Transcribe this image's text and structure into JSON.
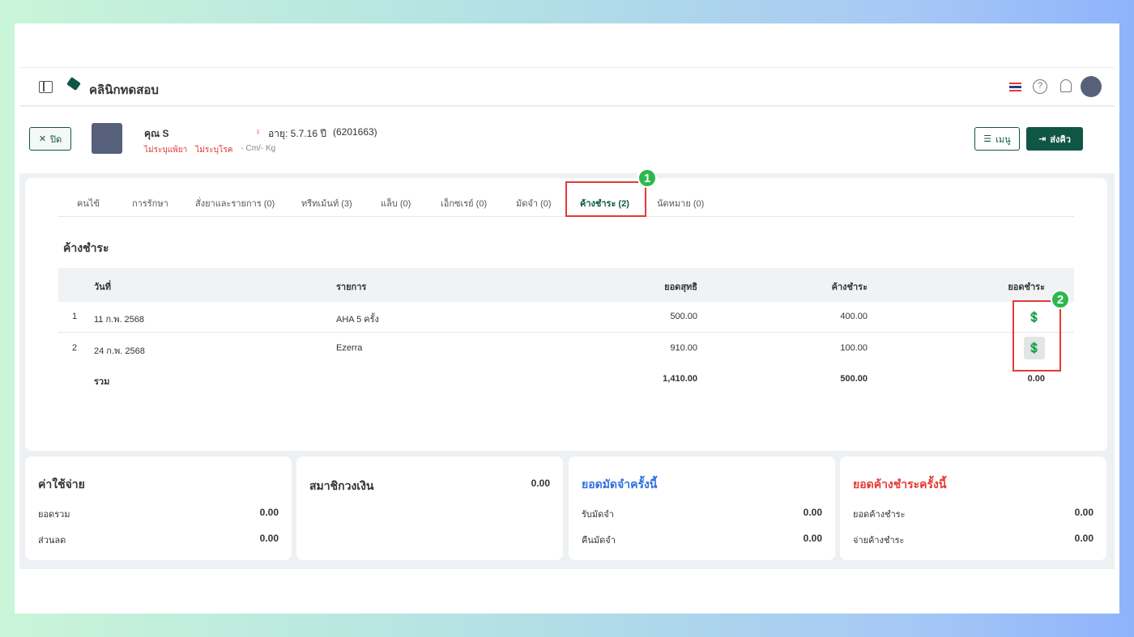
{
  "header": {
    "clinic_name": "คลินิกทดสอบ"
  },
  "patient": {
    "close_label": "ปิด",
    "name": "คุณ S",
    "age": "อายุ: 5.7.16 ปี",
    "hn": "(6201663)",
    "allergy": "ไม่ระบุแพ้ยา",
    "disease": "ไม่ระบุโรค",
    "body": "- Cm/- Kg",
    "menu_label": "เมนู",
    "queue_label": "ส่งคิว"
  },
  "tabs": [
    "คนไข้",
    "การรักษา",
    "สั่งยาและรายการ (0)",
    "ทรีทเม้นท์ (3)",
    "แล็บ (0)",
    "เอ็กซเรย์ (0)",
    "มัดจำ (0)",
    "ค้างชำระ (2)",
    "นัดหมาย (0)"
  ],
  "section_title": "ค้างชำระ",
  "table": {
    "headers": [
      "วันที่",
      "รายการ",
      "ยอดสุทธิ",
      "ค้างชำระ",
      "ยอดชำระ"
    ],
    "rows": [
      {
        "no": "1",
        "date": "11 ก.พ. 2568",
        "item": "AHA 5 ครั้ง",
        "net": "500.00",
        "owed": "400.00"
      },
      {
        "no": "2",
        "date": "24 ก.พ. 2568",
        "item": "Ezerra",
        "net": "910.00",
        "owed": "100.00"
      }
    ],
    "total": {
      "label": "รวม",
      "net": "1,410.00",
      "owed": "500.00",
      "paid": "0.00"
    }
  },
  "summary": {
    "expenses": {
      "title": "ค่าใช้จ่าย",
      "rows": [
        [
          "ยอดรวม",
          "0.00"
        ],
        [
          "ส่วนลด",
          "0.00"
        ]
      ]
    },
    "wallet": {
      "title": "สมาชิกวงเงิน",
      "value": "0.00"
    },
    "deposit": {
      "title": "ยอดมัดจำครั้งนี้",
      "rows": [
        [
          "รับมัดจำ",
          "0.00"
        ],
        [
          "คืนมัดจำ",
          "0.00"
        ]
      ]
    },
    "outstanding": {
      "title": "ยอดค้างชำระครั้งนี้",
      "rows": [
        [
          "ยอดค้างชำระ",
          "0.00"
        ],
        [
          "จ่ายค้างชำระ",
          "0.00"
        ]
      ]
    }
  },
  "annotations": [
    "1",
    "2"
  ],
  "colors": {
    "primary": "#0f5744",
    "blue": "#2f6fe0",
    "red": "#e53935"
  }
}
